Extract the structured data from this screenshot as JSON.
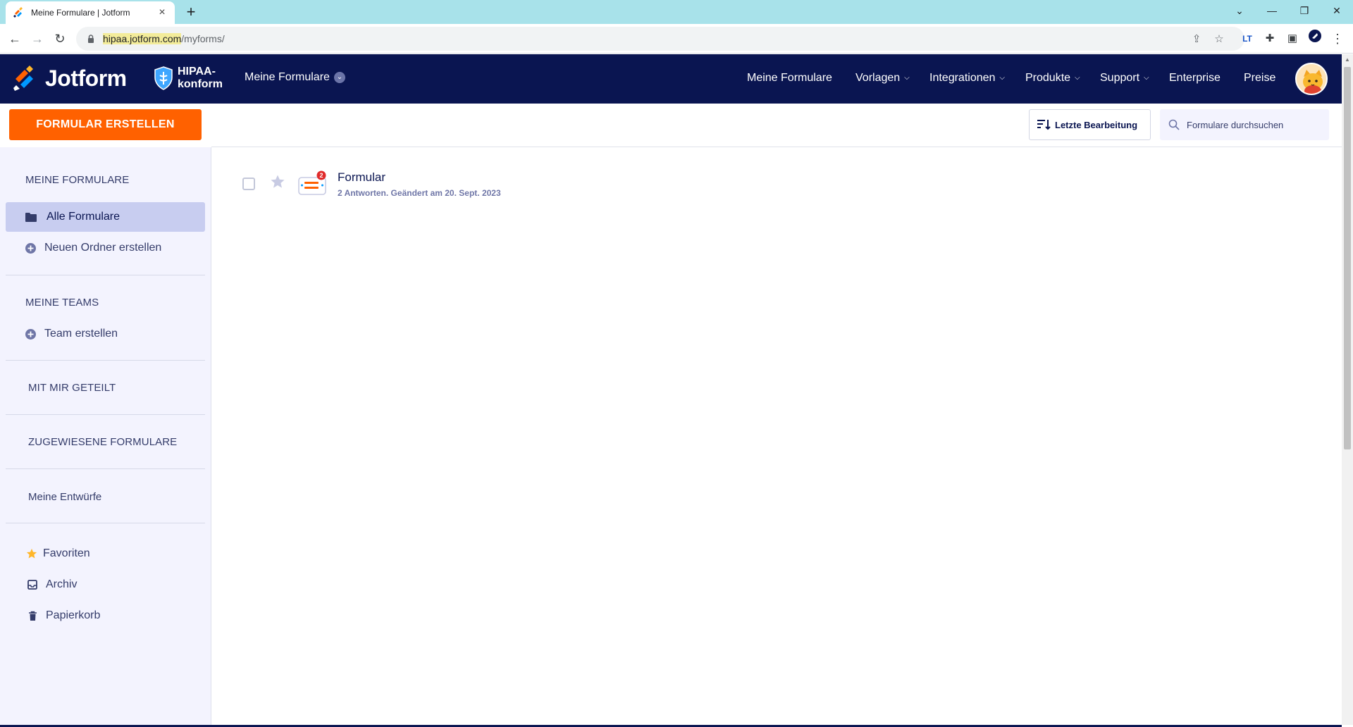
{
  "browser": {
    "tab_title": "Meine Formulare | Jotform",
    "url_host": "hipaa.jotform.com",
    "url_path": "/myforms/"
  },
  "header": {
    "logo_text": "Jotform",
    "hipaa_line1": "HIPAA-",
    "hipaa_line2": "konform",
    "myforms_dropdown": "Meine Formulare",
    "nav": [
      {
        "label": "Meine Formulare",
        "has_caret": false
      },
      {
        "label": "Vorlagen",
        "has_caret": true
      },
      {
        "label": "Integrationen",
        "has_caret": true
      },
      {
        "label": "Produkte",
        "has_caret": true
      },
      {
        "label": "Support",
        "has_caret": true
      },
      {
        "label": "Enterprise",
        "has_caret": false
      },
      {
        "label": "Preise",
        "has_caret": false
      }
    ]
  },
  "toolbar": {
    "create_label": "FORMULAR ERSTELLEN",
    "sort_label": "Letzte Bearbeitung",
    "search_placeholder": "Formulare durchsuchen"
  },
  "sidebar": {
    "section_my_forms": "MEINE FORMULARE",
    "all_forms": "Alle Formulare",
    "new_folder": "Neuen Ordner erstellen",
    "section_teams": "MEINE TEAMS",
    "create_team": "Team erstellen",
    "shared_with_me": "MIT MIR GETEILT",
    "assigned_forms": "ZUGEWIESENE FORMULARE",
    "my_drafts": "Meine Entwürfe",
    "favorites": "Favoriten",
    "archive": "Archiv",
    "trash": "Papierkorb"
  },
  "forms": [
    {
      "title": "Formular",
      "meta": "2 Antworten. Geändert am 20. Sept. 2023",
      "badge": "2"
    }
  ],
  "colors": {
    "header_bg": "#0a1551",
    "create_button": "#ff6100",
    "sidebar_bg": "#f3f3fe",
    "active_item": "#c8cdf0",
    "badge": "#e02a2a"
  }
}
